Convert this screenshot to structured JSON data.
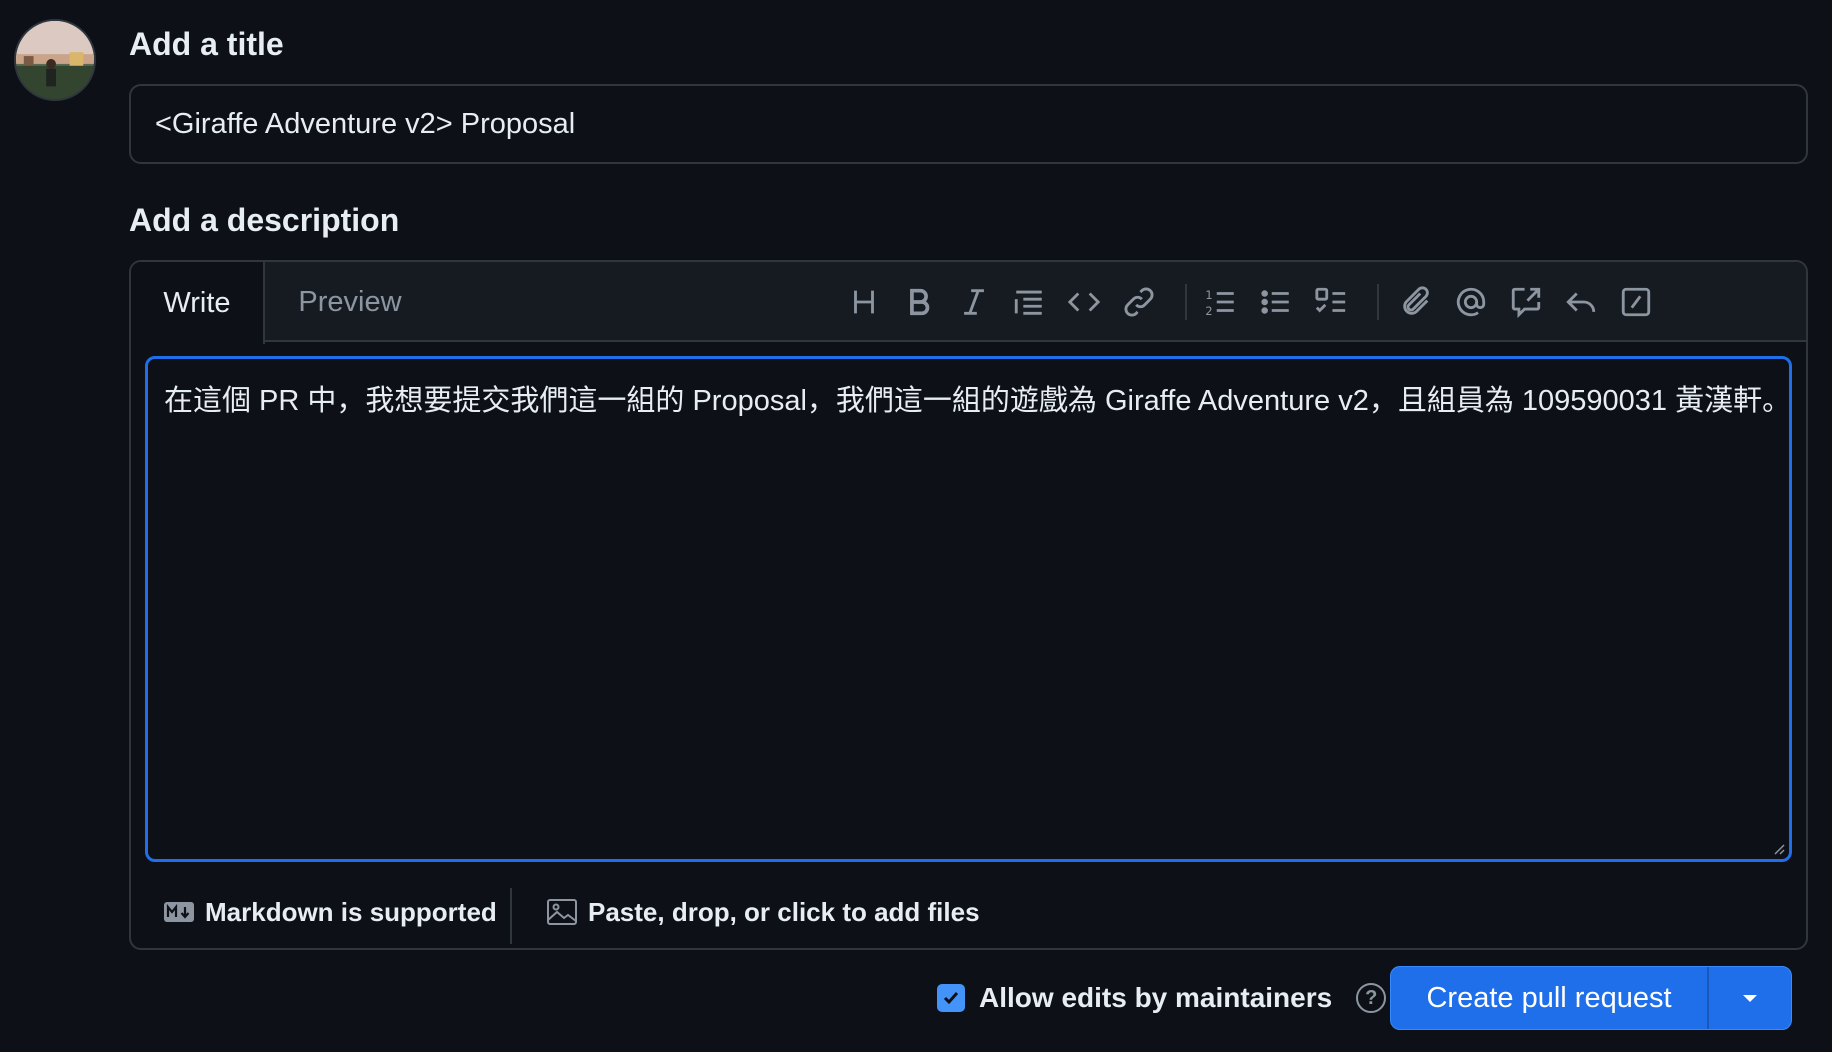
{
  "avatar": {
    "icon": "user-avatar"
  },
  "title_section": {
    "label": "Add a title",
    "value": "<Giraffe Adventure v2> Proposal"
  },
  "description_section": {
    "label": "Add a description",
    "tabs": [
      {
        "label": "Write",
        "active": true
      },
      {
        "label": "Preview",
        "active": false
      }
    ],
    "toolbar": [
      "heading-icon",
      "bold-icon",
      "italic-icon",
      "quote-icon",
      "code-icon",
      "link-icon",
      "ordered-list-icon",
      "unordered-list-icon",
      "task-list-icon",
      "attach-icon",
      "mention-icon",
      "cross-reference-icon",
      "reply-icon",
      "slash-commands-icon"
    ],
    "body_text": "在這個 PR 中，我想要提交我們這一組的 Proposal，我們這一組的遊戲為 Giraffe Adventure v2，且組員為 109590031 黃漢軒。",
    "footer": {
      "markdown_label": "Markdown is supported",
      "files_label": "Paste, drop, or click to add files"
    }
  },
  "actions": {
    "allow_edits_label": "Allow edits by maintainers",
    "allow_edits_checked": true,
    "create_label": "Create pull request"
  },
  "colors": {
    "background": "#0d1117",
    "border": "#30363d",
    "accent": "#1f6feb",
    "text": "#e6edf3",
    "muted": "#8d96a0"
  }
}
